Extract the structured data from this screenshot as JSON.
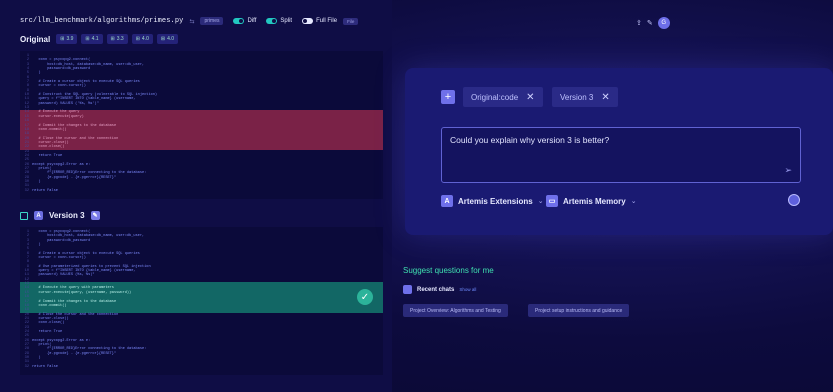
{
  "header": {
    "path": "src/llm_benchmark/algorithms/primes.py",
    "separator": "⇆",
    "file_tag": "primes",
    "diff_label": "Diff",
    "split_label": "Split",
    "full_file_label": "Full File",
    "full_file_tag": "File",
    "avatar_letter": "G",
    "icons": [
      "share-icon",
      "pin-icon"
    ]
  },
  "original": {
    "title": "Original",
    "chips": [
      {
        "icon": "⊞",
        "value": "3.9"
      },
      {
        "icon": "⊞",
        "value": "4.1"
      },
      {
        "icon": "⊞",
        "value": "3.3"
      },
      {
        "icon": "⊞",
        "value": "4.0"
      },
      {
        "icon": "⊞",
        "value": "4.0"
      }
    ]
  },
  "version3": {
    "title": "Version 3"
  },
  "code_original": [
    {
      "t": "",
      "s": ""
    },
    {
      "t": "   conn = psycopg2.connect(",
      "s": ""
    },
    {
      "t": "       host=db_host, database=db_name, user=db_user,",
      "s": ""
    },
    {
      "t": "       password=db_password",
      "s": ""
    },
    {
      "t": "   )",
      "s": ""
    },
    {
      "t": "",
      "s": ""
    },
    {
      "t": "   # Create a cursor object to execute SQL queries",
      "s": ""
    },
    {
      "t": "   cursor = conn.cursor()",
      "s": ""
    },
    {
      "t": "",
      "s": ""
    },
    {
      "t": "   # Construct the SQL query (vulnerable to SQL injection)",
      "s": ""
    },
    {
      "t": "   query = f\"INSERT INTO {table_name} (username,",
      "s": ""
    },
    {
      "t": "   password) VALUES ('%s, %s')\"",
      "s": ""
    },
    {
      "t": "",
      "s": ""
    },
    {
      "t": "   # Execute the query",
      "s": "red"
    },
    {
      "t": "   cursor.execute(query)",
      "s": "red"
    },
    {
      "t": "",
      "s": "red"
    },
    {
      "t": "   # Commit the changes to the database",
      "s": "red"
    },
    {
      "t": "   conn.commit()",
      "s": "red"
    },
    {
      "t": "",
      "s": "red"
    },
    {
      "t": "   # Close the cursor and the connection",
      "s": "red"
    },
    {
      "t": "   cursor.close()",
      "s": "red"
    },
    {
      "t": "   conn.close()",
      "s": "red"
    },
    {
      "t": "",
      "s": ""
    },
    {
      "t": "   return True",
      "s": ""
    },
    {
      "t": "",
      "s": ""
    },
    {
      "t": "except psycopg2.Error as e:",
      "s": ""
    },
    {
      "t": "   print(",
      "s": ""
    },
    {
      "t": "       f\"{ERROR_RED}Error connecting to the database:",
      "s": ""
    },
    {
      "t": "       {e.pgcode} - {e.pgerror}{RESET}\"",
      "s": ""
    },
    {
      "t": "   )",
      "s": ""
    },
    {
      "t": "",
      "s": ""
    },
    {
      "t": "return False",
      "s": ""
    }
  ],
  "code_v3": [
    {
      "t": "   conn = psycopg2.connect(",
      "s": ""
    },
    {
      "t": "       host=db_host, database=db_name, user=db_user,",
      "s": ""
    },
    {
      "t": "       password=db_password",
      "s": ""
    },
    {
      "t": "   )",
      "s": ""
    },
    {
      "t": "",
      "s": ""
    },
    {
      "t": "   # Create a cursor object to execute SQL queries",
      "s": ""
    },
    {
      "t": "   cursor = conn.cursor()",
      "s": ""
    },
    {
      "t": "",
      "s": ""
    },
    {
      "t": "   # Use parameterized queries to prevent SQL injection",
      "s": ""
    },
    {
      "t": "   query = f\"INSERT INTO {table_name} (username,",
      "s": ""
    },
    {
      "t": "   password) VALUES (%s, %s)\"",
      "s": ""
    },
    {
      "t": "",
      "s": ""
    },
    {
      "t": "",
      "s": "green"
    },
    {
      "t": "   # Execute the query with parameters",
      "s": "green"
    },
    {
      "t": "   cursor.execute(query, (username, password))",
      "s": "green"
    },
    {
      "t": "",
      "s": "green"
    },
    {
      "t": "   # Commit the changes to the database",
      "s": "green"
    },
    {
      "t": "   conn.commit()",
      "s": "green"
    },
    {
      "t": "",
      "s": "green"
    },
    {
      "t": "   # Close the cursor and the connection",
      "s": ""
    },
    {
      "t": "   cursor.close()",
      "s": ""
    },
    {
      "t": "   conn.close()",
      "s": ""
    },
    {
      "t": "",
      "s": ""
    },
    {
      "t": "   return True",
      "s": ""
    },
    {
      "t": "",
      "s": ""
    },
    {
      "t": "except psycopg2.Error as e:",
      "s": ""
    },
    {
      "t": "   print(",
      "s": ""
    },
    {
      "t": "       f\"{ERROR_RED}Error connecting to the database:",
      "s": ""
    },
    {
      "t": "       {e.pgcode} - {e.pgerror}{RESET}\"",
      "s": ""
    },
    {
      "t": "   )",
      "s": ""
    },
    {
      "t": "",
      "s": ""
    },
    {
      "t": "return False",
      "s": ""
    }
  ],
  "chat": {
    "context_chips": [
      "Original:code",
      "Version 3"
    ],
    "input_text": "Could you explain why version 3 is better?",
    "dropdowns": [
      "Artemis Extensions",
      "Artemis Memory"
    ]
  },
  "suggest": {
    "title": "Suggest questions for me",
    "recent_label": "Recent chats",
    "show_all": "Show all",
    "questions": [
      "Project Overview: Algorithms and Testing",
      "Project setup instructions and guidance"
    ]
  },
  "colors": {
    "accent": "#6f70ea",
    "green_accent": "#3fe0b0",
    "removed": "#7a2247",
    "added": "#126765"
  }
}
